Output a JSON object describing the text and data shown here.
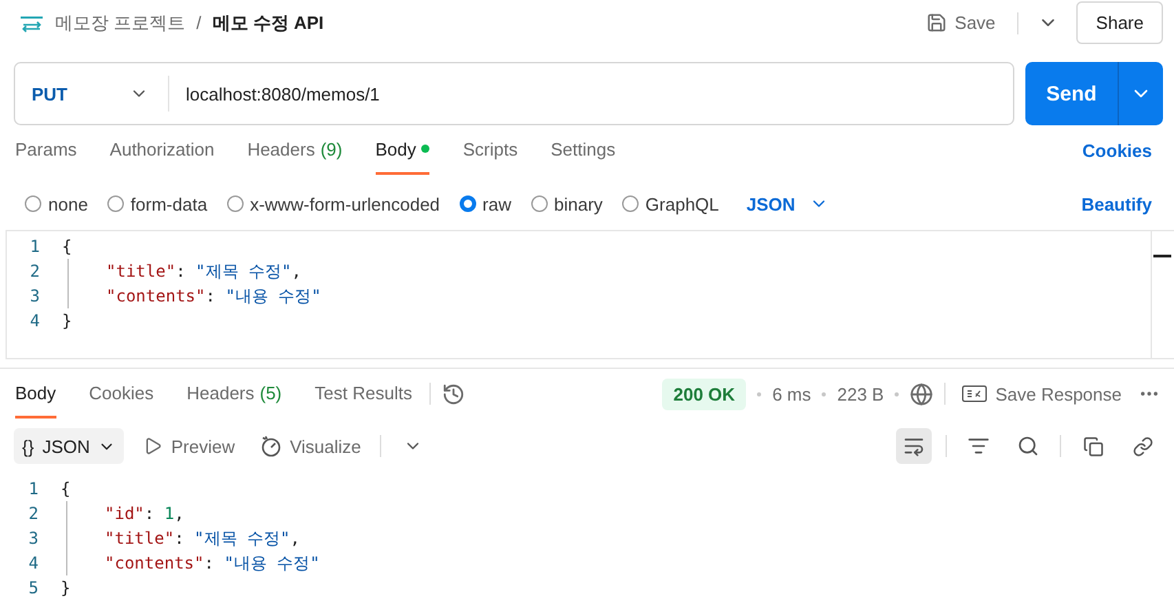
{
  "header": {
    "breadcrumb": "메모장 프로젝트",
    "separator": "/",
    "title": "메모 수정 API",
    "save": "Save",
    "share": "Share"
  },
  "request": {
    "method": "PUT",
    "url": "localhost:8080/memos/1",
    "send": "Send"
  },
  "request_tabs": [
    {
      "label": "Params",
      "selected": false,
      "dot": false
    },
    {
      "label": "Authorization",
      "selected": false,
      "dot": false
    },
    {
      "label": "Headers",
      "count": "(9)",
      "selected": false,
      "dot": false
    },
    {
      "label": "Body",
      "selected": true,
      "dot": true
    },
    {
      "label": "Scripts",
      "selected": false,
      "dot": false
    },
    {
      "label": "Settings",
      "selected": false,
      "dot": false
    }
  ],
  "cookies_link": "Cookies",
  "body_types": [
    {
      "label": "none",
      "selected": false
    },
    {
      "label": "form-data",
      "selected": false
    },
    {
      "label": "x-www-form-urlencoded",
      "selected": false
    },
    {
      "label": "raw",
      "selected": true
    },
    {
      "label": "binary",
      "selected": false
    },
    {
      "label": "GraphQL",
      "selected": false
    }
  ],
  "format": "JSON",
  "beautify": "Beautify",
  "request_body": [
    {
      "number": "1",
      "kind": "brace",
      "tokens": [
        {
          "kind": "punct",
          "text": "{"
        }
      ]
    },
    {
      "number": "2",
      "kind": "member",
      "tokens": [
        {
          "kind": "key",
          "text": "\"title\""
        },
        {
          "kind": "punct",
          "text": ": "
        },
        {
          "kind": "string",
          "text": "\"제목 수정\""
        },
        {
          "kind": "punct",
          "text": ","
        }
      ]
    },
    {
      "number": "3",
      "kind": "member",
      "tokens": [
        {
          "kind": "key",
          "text": "\"contents\""
        },
        {
          "kind": "punct",
          "text": ": "
        },
        {
          "kind": "string",
          "text": "\"내용 수정\""
        }
      ]
    },
    {
      "number": "4",
      "kind": "brace",
      "tokens": [
        {
          "kind": "punct",
          "text": "}"
        }
      ]
    }
  ],
  "response_tabs": [
    {
      "label": "Body",
      "selected": true
    },
    {
      "label": "Cookies",
      "selected": false
    },
    {
      "label": "Headers",
      "count": "(5)",
      "selected": false
    },
    {
      "label": "Test Results",
      "selected": false
    }
  ],
  "response_meta": {
    "status": "200 OK",
    "time": "6 ms",
    "size": "223 B",
    "save_response": "Save Response"
  },
  "response_toolbar": {
    "format_icon": "{}",
    "format": "JSON",
    "preview": "Preview",
    "visualize": "Visualize"
  },
  "response_body": [
    {
      "number": "1",
      "kind": "brace",
      "tokens": [
        {
          "kind": "punct",
          "text": "{"
        }
      ]
    },
    {
      "number": "2",
      "kind": "member",
      "tokens": [
        {
          "kind": "key",
          "text": "\"id\""
        },
        {
          "kind": "punct",
          "text": ": "
        },
        {
          "kind": "number",
          "text": "1"
        },
        {
          "kind": "punct",
          "text": ","
        }
      ]
    },
    {
      "number": "3",
      "kind": "member",
      "tokens": [
        {
          "kind": "key",
          "text": "\"title\""
        },
        {
          "kind": "punct",
          "text": ": "
        },
        {
          "kind": "string",
          "text": "\"제목 수정\""
        },
        {
          "kind": "punct",
          "text": ","
        }
      ]
    },
    {
      "number": "4",
      "kind": "member",
      "tokens": [
        {
          "kind": "key",
          "text": "\"contents\""
        },
        {
          "kind": "punct",
          "text": ": "
        },
        {
          "kind": "string",
          "text": "\"내용 수정\""
        }
      ]
    },
    {
      "number": "5",
      "kind": "brace",
      "tokens": [
        {
          "kind": "punct",
          "text": "}"
        }
      ]
    }
  ]
}
